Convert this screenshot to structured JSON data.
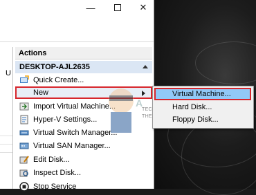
{
  "window": {
    "minimize_glyph": "—",
    "close_glyph": "✕"
  },
  "left_pane": {
    "column_letter": "U"
  },
  "actions": {
    "header": "Actions",
    "group_title": "DESKTOP-AJL2635",
    "items": [
      {
        "label": "Quick Create...",
        "icon": "quick-create-icon"
      },
      {
        "label": "New",
        "icon": "new-icon"
      },
      {
        "label": "Import Virtual Machine...",
        "icon": "import-icon"
      },
      {
        "label": "Hyper-V Settings...",
        "icon": "settings-icon"
      },
      {
        "label": "Virtual Switch Manager...",
        "icon": "switch-icon"
      },
      {
        "label": "Virtual SAN Manager...",
        "icon": "san-icon"
      },
      {
        "label": "Edit Disk...",
        "icon": "edit-disk-icon"
      },
      {
        "label": "Inspect Disk...",
        "icon": "inspect-disk-icon"
      },
      {
        "label": "Stop Service",
        "icon": "stop-icon"
      }
    ]
  },
  "submenu": {
    "items": [
      {
        "label": "Virtual Machine..."
      },
      {
        "label": "Hard Disk..."
      },
      {
        "label": "Floppy Disk..."
      }
    ]
  },
  "watermark": {
    "line1": "TECH HOW-TO'S FROM",
    "line2": "THE EXPERTS!"
  },
  "colors": {
    "highlight_border": "#d7262c",
    "submenu_selected": "#91c9f7",
    "group_header": "#dbe6f4"
  }
}
